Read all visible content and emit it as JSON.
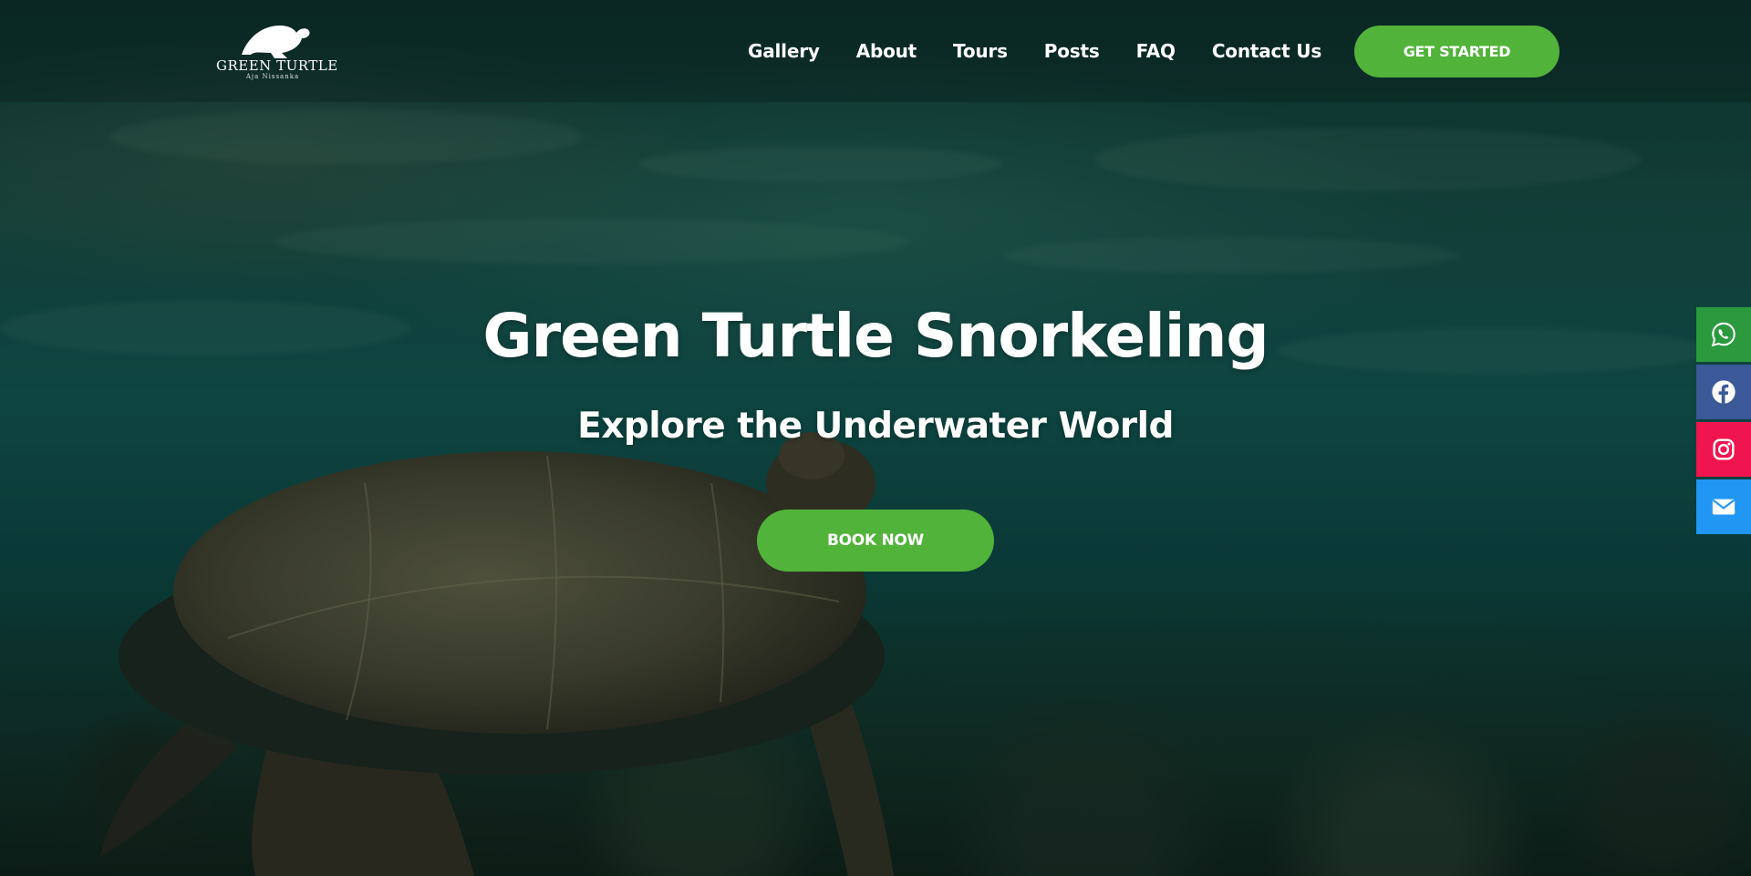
{
  "brand": {
    "name": "GREEN TURTLE",
    "subtitle": "Aja Nissanka"
  },
  "nav": {
    "items": [
      {
        "label": "Gallery"
      },
      {
        "label": "About"
      },
      {
        "label": "Tours"
      },
      {
        "label": "Posts"
      },
      {
        "label": "FAQ"
      },
      {
        "label": "Contact Us"
      }
    ],
    "cta_label": "GET STARTED"
  },
  "hero": {
    "title": "Green Turtle Snorkeling",
    "subtitle": "Explore the Underwater World",
    "button_label": "BOOK NOW"
  },
  "social": [
    {
      "name": "whatsapp",
      "icon": "whatsapp-icon",
      "color": "#2b9a3e"
    },
    {
      "name": "facebook",
      "icon": "facebook-icon",
      "color": "#3b5998"
    },
    {
      "name": "instagram",
      "icon": "instagram-icon",
      "color": "#f0154f"
    },
    {
      "name": "email",
      "icon": "email-icon",
      "color": "#2196f3"
    }
  ],
  "colors": {
    "accent": "#52b33a",
    "text": "#ffffff"
  }
}
